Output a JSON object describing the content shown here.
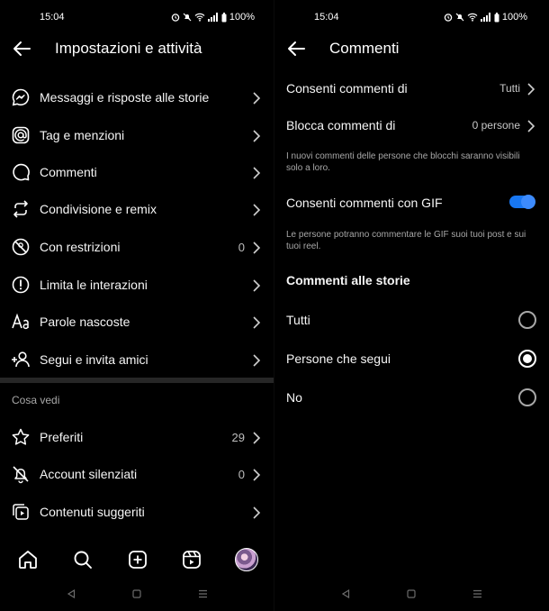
{
  "left": {
    "status": {
      "time": "15:04",
      "battery": "100%"
    },
    "header": {
      "title": "Impostazioni e attività"
    },
    "items": [
      {
        "label": "Messaggi e risposte alle storie",
        "count": ""
      },
      {
        "label": "Tag e menzioni",
        "count": ""
      },
      {
        "label": "Commenti",
        "count": ""
      },
      {
        "label": "Condivisione e remix",
        "count": ""
      },
      {
        "label": "Con restrizioni",
        "count": "0"
      },
      {
        "label": "Limita le interazioni",
        "count": ""
      },
      {
        "label": "Parole nascoste",
        "count": ""
      },
      {
        "label": "Segui e invita amici",
        "count": ""
      }
    ],
    "section_title": "Cosa vedi",
    "see_items": [
      {
        "label": "Preferiti",
        "count": "29"
      },
      {
        "label": "Account silenziati",
        "count": "0"
      },
      {
        "label": "Contenuti suggeriti",
        "count": ""
      }
    ]
  },
  "right": {
    "status": {
      "time": "15:04",
      "battery": "100%"
    },
    "header": {
      "title": "Commenti"
    },
    "allow_comments": {
      "label": "Consenti commenti di",
      "value": "Tutti"
    },
    "block_comments": {
      "label": "Blocca commenti di",
      "value": "0 persone"
    },
    "block_help": "I nuovi commenti delle persone che blocchi saranno visibili solo a loro.",
    "gif": {
      "label": "Consenti commenti con GIF",
      "enabled": true
    },
    "gif_help": "Le persone potranno commentare le GIF suoi tuoi post e sui tuoi reel.",
    "story_title": "Commenti alle storie",
    "story_options": [
      {
        "label": "Tutti",
        "selected": false
      },
      {
        "label": "Persone che segui",
        "selected": true
      },
      {
        "label": "No",
        "selected": false
      }
    ]
  }
}
